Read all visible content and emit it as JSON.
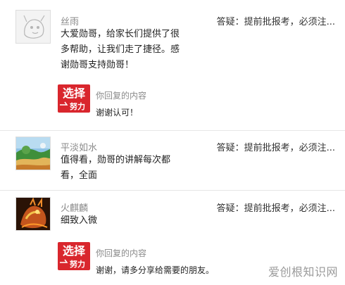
{
  "comments": [
    {
      "username": "丝雨",
      "source": "答疑：提前批报考，必须注...",
      "text": "大爱勋哥，给家长们提供了很多帮助，让我们走了捷径。感谢勋哥支持勋哥！",
      "reply": {
        "label": "你回复的内容",
        "text": "谢谢认可！"
      }
    },
    {
      "username": "平淡如水",
      "source": "答疑：提前批报考，必须注...",
      "text": "值得看，勋哥的讲解每次都看，全面"
    },
    {
      "username": "火麒麟",
      "source": "答疑：提前批报考，必须注...",
      "text": "细致入微",
      "reply": {
        "label": "你回复的内容",
        "text": "谢谢，请多分享给需要的朋友。"
      }
    }
  ],
  "watermark": "爱创根知识网",
  "logo_glyphs": {
    "top": "选择",
    "bottom": "努力"
  },
  "colors": {
    "logo_red": "#d9262d",
    "muted": "#8a8a8a",
    "divider": "#e6e6e6"
  }
}
